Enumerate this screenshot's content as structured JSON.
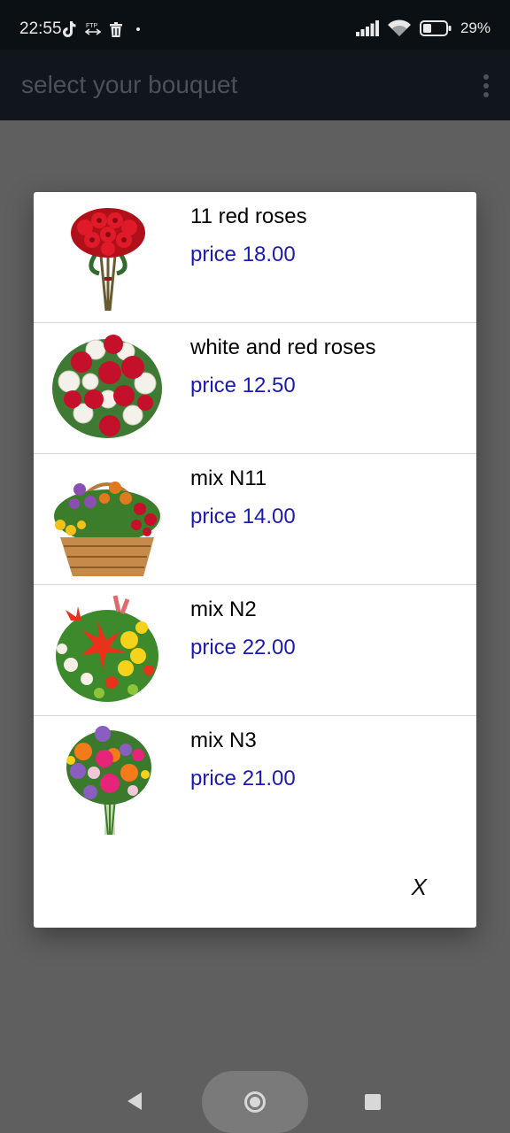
{
  "status_bar": {
    "time": "22:55",
    "battery": "29%",
    "icons": [
      "tiktok-icon",
      "ftp-icon",
      "trash-icon",
      "dot-icon",
      "signal-icon",
      "wifi-icon",
      "battery-icon"
    ]
  },
  "app_bar": {
    "title": "select your bouquet",
    "menu_icon": "more-vert-icon"
  },
  "dialog": {
    "items": [
      {
        "name": "11 red roses",
        "price": "price 18.00",
        "image": "red-roses-bouquet"
      },
      {
        "name": "white and red roses",
        "price": "price 12.50",
        "image": "white-red-roses-bouquet"
      },
      {
        "name": "mix N11",
        "price": "price 14.00",
        "image": "flower-basket"
      },
      {
        "name": "mix N2",
        "price": "price 22.00",
        "image": "lily-mix-bouquet"
      },
      {
        "name": "mix N3",
        "price": "price 21.00",
        "image": "gerbera-mix-bouquet"
      }
    ],
    "close_label": "X"
  },
  "nav_bar": {
    "icons": [
      "back-icon",
      "home-icon",
      "recents-icon"
    ]
  },
  "colors": {
    "status_bar_bg": "#0b1014",
    "app_bar_bg": "#10161c",
    "scrim": "#5f5f5f",
    "price_text": "#1a1ab5"
  }
}
